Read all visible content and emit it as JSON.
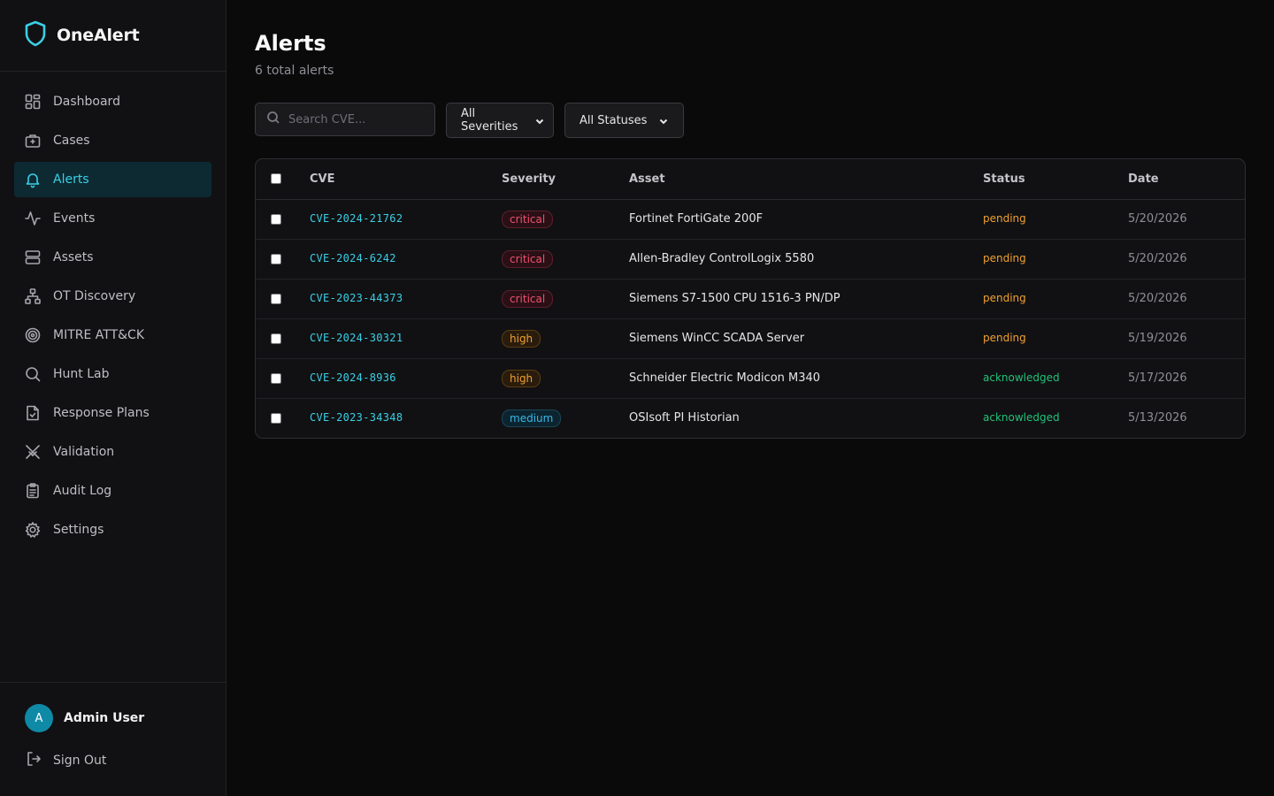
{
  "app": {
    "name": "OneAlert",
    "accent": "#3ad0e6"
  },
  "sidebar": {
    "items": [
      {
        "label": "Dashboard",
        "icon": "dashboard-icon",
        "active": false
      },
      {
        "label": "Cases",
        "icon": "briefcase-icon",
        "active": false
      },
      {
        "label": "Alerts",
        "icon": "bell-icon",
        "active": true
      },
      {
        "label": "Events",
        "icon": "activity-icon",
        "active": false
      },
      {
        "label": "Assets",
        "icon": "server-icon",
        "active": false
      },
      {
        "label": "OT Discovery",
        "icon": "network-icon",
        "active": false
      },
      {
        "label": "MITRE ATT&CK",
        "icon": "target-icon",
        "active": false
      },
      {
        "label": "Hunt Lab",
        "icon": "search-icon",
        "active": false
      },
      {
        "label": "Response Plans",
        "icon": "file-check-icon",
        "active": false
      },
      {
        "label": "Validation",
        "icon": "swords-icon",
        "active": false
      },
      {
        "label": "Audit Log",
        "icon": "clipboard-icon",
        "active": false
      },
      {
        "label": "Settings",
        "icon": "gear-icon",
        "active": false
      }
    ],
    "user": {
      "initial": "A",
      "name": "Admin User"
    },
    "signout_label": "Sign Out"
  },
  "page": {
    "title": "Alerts",
    "subtitle": "6 total alerts"
  },
  "filters": {
    "search_placeholder": "Search CVE...",
    "severity_selected": "All Severities",
    "status_selected": "All Statuses"
  },
  "table": {
    "headers": [
      "CVE",
      "Severity",
      "Asset",
      "Status",
      "Date"
    ],
    "rows": [
      {
        "cve": "CVE-2024-21762",
        "severity": "critical",
        "asset": "Fortinet FortiGate 200F",
        "status": "pending",
        "date": "5/20/2026"
      },
      {
        "cve": "CVE-2024-6242",
        "severity": "critical",
        "asset": "Allen-Bradley ControlLogix 5580",
        "status": "pending",
        "date": "5/20/2026"
      },
      {
        "cve": "CVE-2023-44373",
        "severity": "critical",
        "asset": "Siemens S7-1500 CPU 1516-3 PN/DP",
        "status": "pending",
        "date": "5/20/2026"
      },
      {
        "cve": "CVE-2024-30321",
        "severity": "high",
        "asset": "Siemens WinCC SCADA Server",
        "status": "pending",
        "date": "5/19/2026"
      },
      {
        "cve": "CVE-2024-8936",
        "severity": "high",
        "asset": "Schneider Electric Modicon M340",
        "status": "acknowledged",
        "date": "5/17/2026"
      },
      {
        "cve": "CVE-2023-34348",
        "severity": "medium",
        "asset": "OSIsoft PI Historian",
        "status": "acknowledged",
        "date": "5/13/2026"
      }
    ]
  }
}
